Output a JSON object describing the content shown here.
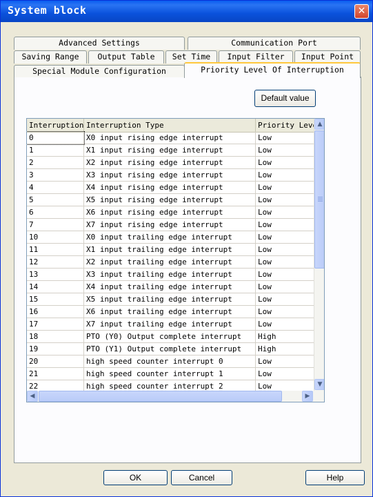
{
  "window": {
    "title": "System block",
    "close_icon": "close-icon"
  },
  "tabs": [
    {
      "id": "advanced",
      "label": "Advanced Settings"
    },
    {
      "id": "comm",
      "label": "Communication Port"
    },
    {
      "id": "saving",
      "label": "Saving Range"
    },
    {
      "id": "output",
      "label": "Output Table"
    },
    {
      "id": "settime",
      "label": "Set Time"
    },
    {
      "id": "filter",
      "label": "Input Filter"
    },
    {
      "id": "inputpoint",
      "label": "Input Point"
    },
    {
      "id": "special",
      "label": "Special Module Configuration"
    },
    {
      "id": "priority",
      "label": "Priority Level Of Interruption",
      "active": true
    }
  ],
  "panel": {
    "default_button": "Default value"
  },
  "table": {
    "columns": [
      "Interruption",
      "Interruption Type",
      "Priority Level"
    ],
    "rows": [
      [
        "0",
        "X0 input rising edge interrupt",
        "Low"
      ],
      [
        "1",
        "X1 input rising edge interrupt",
        "Low"
      ],
      [
        "2",
        "X2 input rising edge interrupt",
        "Low"
      ],
      [
        "3",
        "X3 input rising edge interrupt",
        "Low"
      ],
      [
        "4",
        "X4 input rising edge interrupt",
        "Low"
      ],
      [
        "5",
        "X5 input rising edge interrupt",
        "Low"
      ],
      [
        "6",
        "X6 input rising edge interrupt",
        "Low"
      ],
      [
        "7",
        "X7 input rising edge interrupt",
        "Low"
      ],
      [
        "10",
        "X0 input trailing edge interrupt",
        "Low"
      ],
      [
        "11",
        "X1 input trailing edge interrupt",
        "Low"
      ],
      [
        "12",
        "X2 input trailing edge interrupt",
        "Low"
      ],
      [
        "13",
        "X3 input trailing edge interrupt",
        "Low"
      ],
      [
        "14",
        "X4 input trailing edge interrupt",
        "Low"
      ],
      [
        "15",
        "X5 input trailing edge interrupt",
        "Low"
      ],
      [
        "16",
        "X6 input trailing edge interrupt",
        "Low"
      ],
      [
        "17",
        "X7 input trailing edge interrupt",
        "Low"
      ],
      [
        "18",
        "PTO (Y0) Output complete interrupt",
        "High"
      ],
      [
        "19",
        "PTO (Y1) Output complete interrupt",
        "High"
      ],
      [
        "20",
        "high speed counter interrupt 0",
        "Low"
      ],
      [
        "21",
        "high speed counter interrupt 1",
        "Low"
      ],
      [
        "22",
        "high speed counter interrupt 2",
        "Low"
      ]
    ]
  },
  "footer": {
    "ok": "OK",
    "cancel": "Cancel",
    "help": "Help"
  }
}
